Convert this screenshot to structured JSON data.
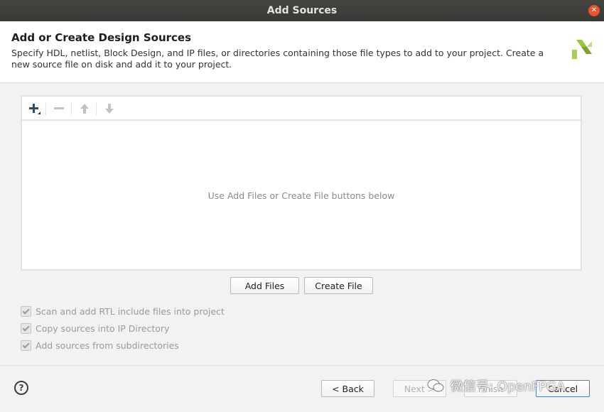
{
  "window": {
    "title": "Add Sources"
  },
  "header": {
    "title": "Add or Create Design Sources",
    "description": "Specify HDL, netlist, Block Design, and IP files, or directories containing those file types to add to your project. Create a new source file on disk and add it to your project."
  },
  "panel": {
    "empty_message": "Use Add Files or Create File buttons below",
    "toolbar": [
      "plus-icon",
      "minus-icon",
      "arrow-up-icon",
      "arrow-down-icon"
    ]
  },
  "buttons": {
    "add_files": "Add Files",
    "create_file": "Create File",
    "back": "< Back",
    "next": "Next >",
    "finish": "Finish",
    "cancel": "Cancel"
  },
  "options": [
    {
      "label": "Scan and add RTL include files into project",
      "checked": true,
      "enabled": false
    },
    {
      "label": "Copy sources into IP Directory",
      "checked": true,
      "enabled": false
    },
    {
      "label": "Add sources from subdirectories",
      "checked": true,
      "enabled": false
    }
  ],
  "help": {
    "label": "?"
  },
  "watermark": {
    "text": "微信号: OpenFPGA"
  },
  "colors": {
    "titlebar": "#3e3d39",
    "close": "#e9542c",
    "logo_green": "#8ab42b"
  }
}
